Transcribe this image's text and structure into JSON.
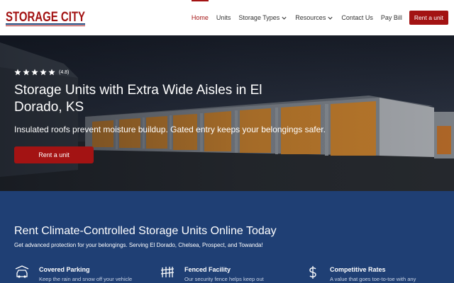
{
  "brand": {
    "logo_text": "STORAGE CITY"
  },
  "nav": {
    "items": [
      {
        "label": "Home",
        "active": true,
        "dropdown": false
      },
      {
        "label": "Units",
        "active": false,
        "dropdown": false
      },
      {
        "label": "Storage Types",
        "active": false,
        "dropdown": true
      },
      {
        "label": "Resources",
        "active": false,
        "dropdown": true
      },
      {
        "label": "Contact Us",
        "active": false,
        "dropdown": false
      },
      {
        "label": "Pay Bill",
        "active": false,
        "dropdown": false
      }
    ],
    "cta_label": "Rent a unit"
  },
  "hero": {
    "rating_value": "(4.8)",
    "stars": 5,
    "title": "Storage Units with Extra Wide Aisles in El Dorado, KS",
    "subtitle": "Insulated roofs prevent moisture buildup. Gated entry keeps your belongings safer.",
    "button_label": "Rent a unit"
  },
  "section": {
    "title": "Rent Climate-Controlled Storage Units Online Today",
    "subtitle": "Get advanced protection for your belongings. Serving El Dorado, Chelsea, Prospect, and Towanda!",
    "features": [
      {
        "icon": "car-icon",
        "title": "Covered Parking",
        "desc": "Keep the rain and snow off your vehicle"
      },
      {
        "icon": "fence-icon",
        "title": "Fenced Facility",
        "desc": "Our security fence helps keep out"
      },
      {
        "icon": "dollar-icon",
        "title": "Competitive Rates",
        "desc": "A value that goes toe-to-toe with any"
      }
    ]
  },
  "colors": {
    "brand_red": "#a31313",
    "section_blue": "#1f3f74",
    "logo_blue": "#1f3f74",
    "star_white": "#ffffff",
    "door_orange": "#d88a2e"
  }
}
